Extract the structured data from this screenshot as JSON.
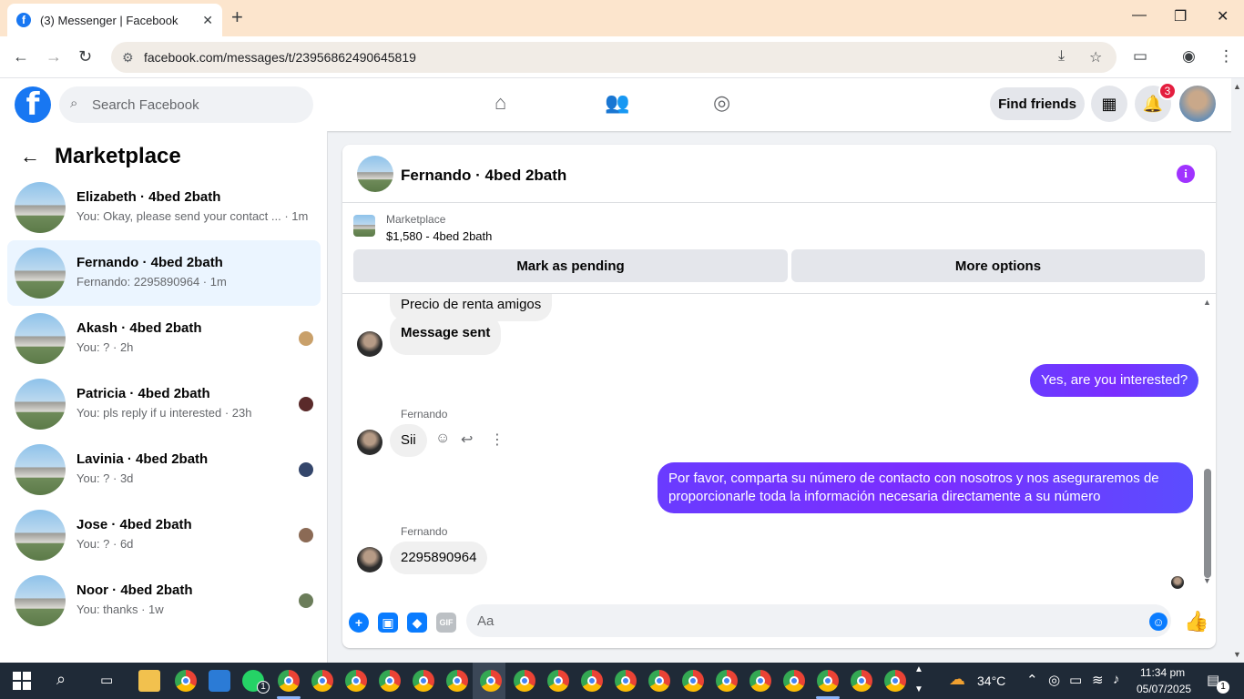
{
  "browser": {
    "tab_title": "(3) Messenger | Facebook",
    "tab_close": "✕",
    "new_tab": "+",
    "url": "facebook.com/messages/t/23956862490645819",
    "minimize": "—",
    "maximize": "❐",
    "close": "✕"
  },
  "fb": {
    "logo": "f",
    "search_placeholder": "Search Facebook",
    "find_friends": "Find friends",
    "notification_count": "3"
  },
  "sidebar": {
    "title": "Marketplace",
    "conversations": [
      {
        "name": "Elizabeth · 4bed 2bath",
        "preview": "You: Okay, please send your contact ... · 1m",
        "active": false
      },
      {
        "name": "Fernando · 4bed 2bath",
        "preview": "Fernando: 2295890964 · 1m",
        "active": true
      },
      {
        "name": "Akash · 4bed 2bath",
        "preview": "You: ? · 2h",
        "active": false
      },
      {
        "name": "Patricia · 4bed 2bath",
        "preview": "You: pls reply if u interested · 23h",
        "active": false
      },
      {
        "name": "Lavinia · 4bed 2bath",
        "preview": "You: ? · 3d",
        "active": false
      },
      {
        "name": "Jose · 4bed 2bath",
        "preview": "You: ? · 6d",
        "active": false
      },
      {
        "name": "Noor · 4bed 2bath",
        "preview": "You: thanks · 1w",
        "active": false
      }
    ]
  },
  "chat": {
    "title": "Fernando · 4bed 2bath",
    "info": "i",
    "marketplace_label": "Marketplace",
    "listing": "$1,580 - 4bed 2bath",
    "mark_pending": "Mark as pending",
    "more_options": "More options",
    "messages": {
      "m1": "Precio de renta amigos",
      "m2": "Message sent",
      "m3": "Yes, are you interested?",
      "sender1": "Fernando",
      "m4": "Sii",
      "m5": "Por favor, comparta su número de contacto con nosotros y nos aseguraremos de proporcionarle toda la información necesaria directamente a su número",
      "sender2": "Fernando",
      "m6": "2295890964"
    },
    "composer_placeholder": "Aa",
    "gif_label": "GIF"
  },
  "taskbar": {
    "weather": "34°C",
    "time": "11:34 pm",
    "date": "05/07/2025",
    "notif_count": "1",
    "whatsapp_count": "1"
  },
  "colors": {
    "fb_blue": "#1877f2",
    "messenger_purple": "#7b2dff",
    "chrome_tab_bg": "#fce5cd"
  }
}
